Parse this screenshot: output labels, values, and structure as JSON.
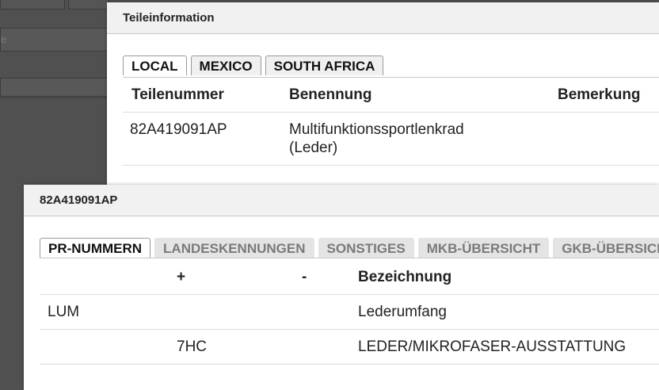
{
  "background": {
    "field_text": "e"
  },
  "dialog1": {
    "title": "Teileinformation",
    "tabs": [
      {
        "label": "LOCAL",
        "active": true
      },
      {
        "label": "MEXICO",
        "active": false
      },
      {
        "label": "SOUTH AFRICA",
        "active": false
      }
    ],
    "columns": [
      "Teilenummer",
      "Benennung",
      "Bemerkung"
    ],
    "rows": [
      {
        "teilenummer": "82A419091AP",
        "benennung_line1": "Multifunktionssportlenkrad",
        "benennung_line2": "(Leder)",
        "bemerkung": ""
      }
    ]
  },
  "dialog2": {
    "title": "82A419091AP",
    "tabs": [
      {
        "label": "PR-NUMMERN",
        "active": true
      },
      {
        "label": "LANDESKENNUNGEN",
        "active": false
      },
      {
        "label": "SONSTIGES",
        "active": false
      },
      {
        "label": "MKB-ÜBERSICHT",
        "active": false
      },
      {
        "label": "GKB-ÜBERSICHT",
        "active": false
      }
    ],
    "columns": [
      "",
      "+",
      "-",
      "Bezeichnung"
    ],
    "rows": [
      {
        "code": "LUM",
        "plus": "",
        "minus": "",
        "bezeichnung": "Lederumfang"
      },
      {
        "code": "",
        "plus": "7HC",
        "minus": "",
        "bezeichnung": "LEDER/MIKROFASER-AUSSTATTUNG"
      }
    ]
  },
  "colors": {
    "overlay": "#505050",
    "header_bg": "#f1f1f1",
    "inactive_tab_text": "#7a7a7a"
  }
}
